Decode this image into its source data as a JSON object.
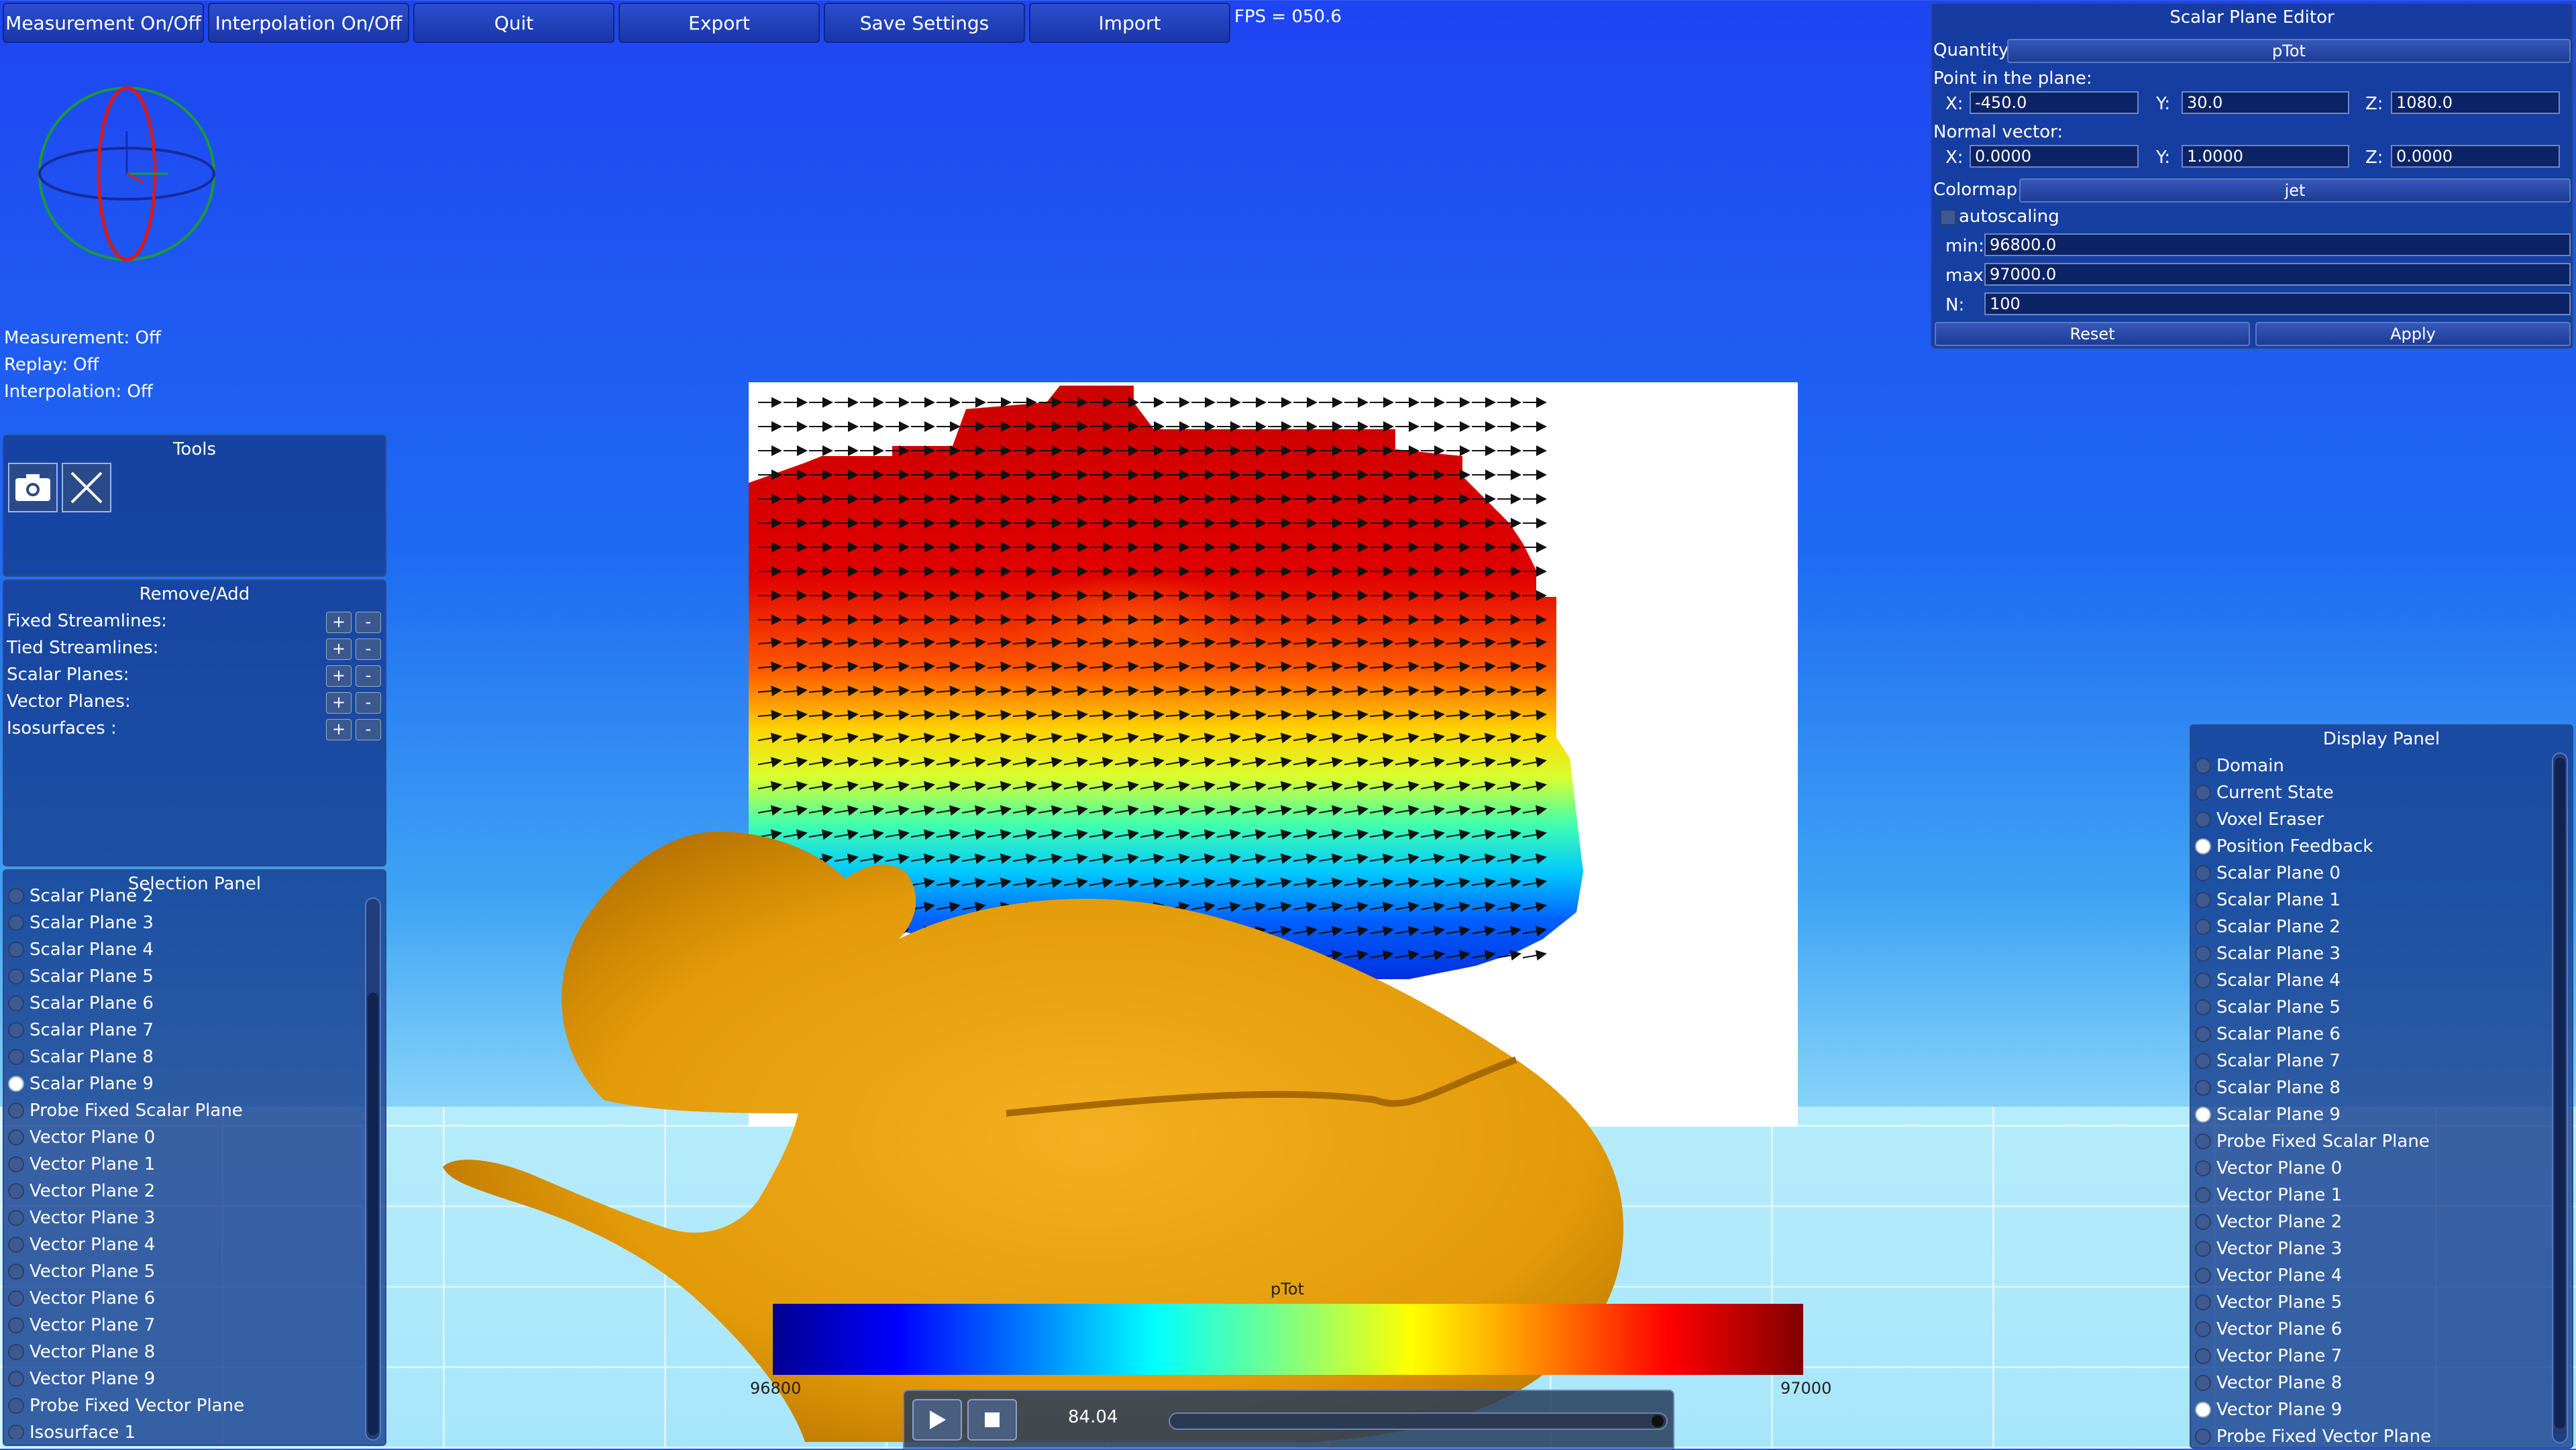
{
  "toolbar": {
    "buttons": [
      "Measurement On/Off",
      "Interpolation On/Off",
      "Quit",
      "Export",
      "Save Settings",
      "Import"
    ]
  },
  "fps": "FPS = 050.6",
  "status": {
    "measurement": "Measurement: Off",
    "replay": "Replay: Off",
    "interpolation": "Interpolation: Off"
  },
  "tools": {
    "title": "Tools",
    "icons": [
      "camera-icon",
      "cross-icon"
    ]
  },
  "remove_add": {
    "title": "Remove/Add",
    "rows": [
      "Fixed Streamlines:",
      "Tied Streamlines:",
      "Scalar Planes:",
      "Vector Planes:",
      "Isosurfaces  :"
    ],
    "plus": "+",
    "minus": "-"
  },
  "selection_panel": {
    "title": "Selection Panel",
    "items": [
      "Scalar Plane 2",
      "Scalar Plane 3",
      "Scalar Plane 4",
      "Scalar Plane 5",
      "Scalar Plane 6",
      "Scalar Plane 7",
      "Scalar Plane 8",
      "Scalar Plane 9",
      "Probe Fixed Scalar Plane",
      "Vector Plane 0",
      "Vector Plane 1",
      "Vector Plane 2",
      "Vector Plane 3",
      "Vector Plane 4",
      "Vector Plane 5",
      "Vector Plane 6",
      "Vector Plane 7",
      "Vector Plane 8",
      "Vector Plane 9",
      "Probe Fixed Vector Plane",
      "Isosurface 1"
    ],
    "selected": "Scalar Plane 9"
  },
  "display_panel": {
    "title": "Display Panel",
    "items": [
      "Domain",
      "Current State",
      "Voxel Eraser",
      "Position Feedback",
      "Scalar Plane 0",
      "Scalar Plane 1",
      "Scalar Plane 2",
      "Scalar Plane 3",
      "Scalar Plane 4",
      "Scalar Plane 5",
      "Scalar Plane 6",
      "Scalar Plane 7",
      "Scalar Plane 8",
      "Scalar Plane 9",
      "Probe Fixed Scalar Plane",
      "Vector Plane 0",
      "Vector Plane 1",
      "Vector Plane 2",
      "Vector Plane 3",
      "Vector Plane 4",
      "Vector Plane 5",
      "Vector Plane 6",
      "Vector Plane 7",
      "Vector Plane 8",
      "Vector Plane 9",
      "Probe Fixed Vector Plane"
    ],
    "checked": [
      "Position Feedback",
      "Scalar Plane 9",
      "Vector Plane 9"
    ]
  },
  "editor": {
    "title": "Scalar Plane Editor",
    "quantity_label": "Quantity:",
    "quantity_value": "pTot",
    "point_label": "Point in the plane:",
    "point": {
      "x": "-450.0",
      "y": "30.0",
      "z": "1080.0"
    },
    "normal_label": "Normal vector:",
    "normal": {
      "x": "0.0000",
      "y": "1.0000",
      "z": "0.0000"
    },
    "x_label": "X:",
    "y_label": "Y:",
    "z_label": "Z:",
    "colormap_label": "Colormap:",
    "colormap_value": "jet",
    "autoscaling_label": "autoscaling",
    "min_label": "min:",
    "min_value": "96800.0",
    "max_label": "max:",
    "max_value": "97000.0",
    "n_label": "N:",
    "n_value": "100",
    "reset": "Reset",
    "apply": "Apply"
  },
  "colorbar": {
    "title": "pTot",
    "min": "96800",
    "max": "97000",
    "colormap": "jet"
  },
  "replay_controls": {
    "time": "84.04",
    "progress": 1.0
  },
  "colors": {
    "panel_bg": "#143a8c",
    "body": "#f0a810",
    "plane_bg": "#ffffff"
  }
}
